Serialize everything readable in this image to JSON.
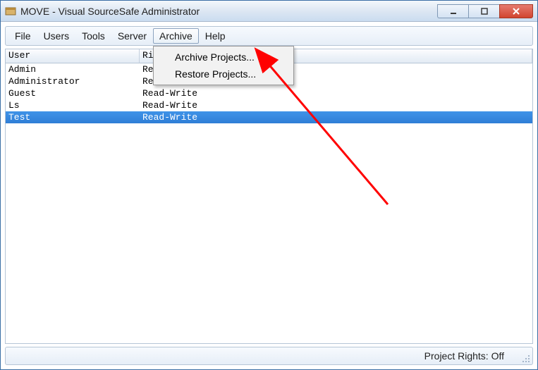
{
  "window": {
    "title": "MOVE - Visual SourceSafe Administrator"
  },
  "menubar": {
    "items": [
      {
        "label": "File"
      },
      {
        "label": "Users"
      },
      {
        "label": "Tools"
      },
      {
        "label": "Server"
      },
      {
        "label": "Archive",
        "active": true
      },
      {
        "label": "Help"
      }
    ]
  },
  "archive_menu": {
    "items": [
      {
        "label": "Archive Projects..."
      },
      {
        "label": "Restore Projects..."
      }
    ]
  },
  "table": {
    "columns": [
      {
        "label": "User"
      },
      {
        "label": "Rights"
      }
    ],
    "rows": [
      {
        "user": "Admin",
        "rights": "Read-Write",
        "selected": false
      },
      {
        "user": "Administrator",
        "rights": "Read-Write",
        "selected": false
      },
      {
        "user": "Guest",
        "rights": "Read-Write",
        "selected": false
      },
      {
        "user": "Ls",
        "rights": "Read-Write",
        "selected": false
      },
      {
        "user": "Test",
        "rights": "Read-Write",
        "selected": true
      }
    ]
  },
  "statusbar": {
    "text": "Project Rights: Off"
  }
}
